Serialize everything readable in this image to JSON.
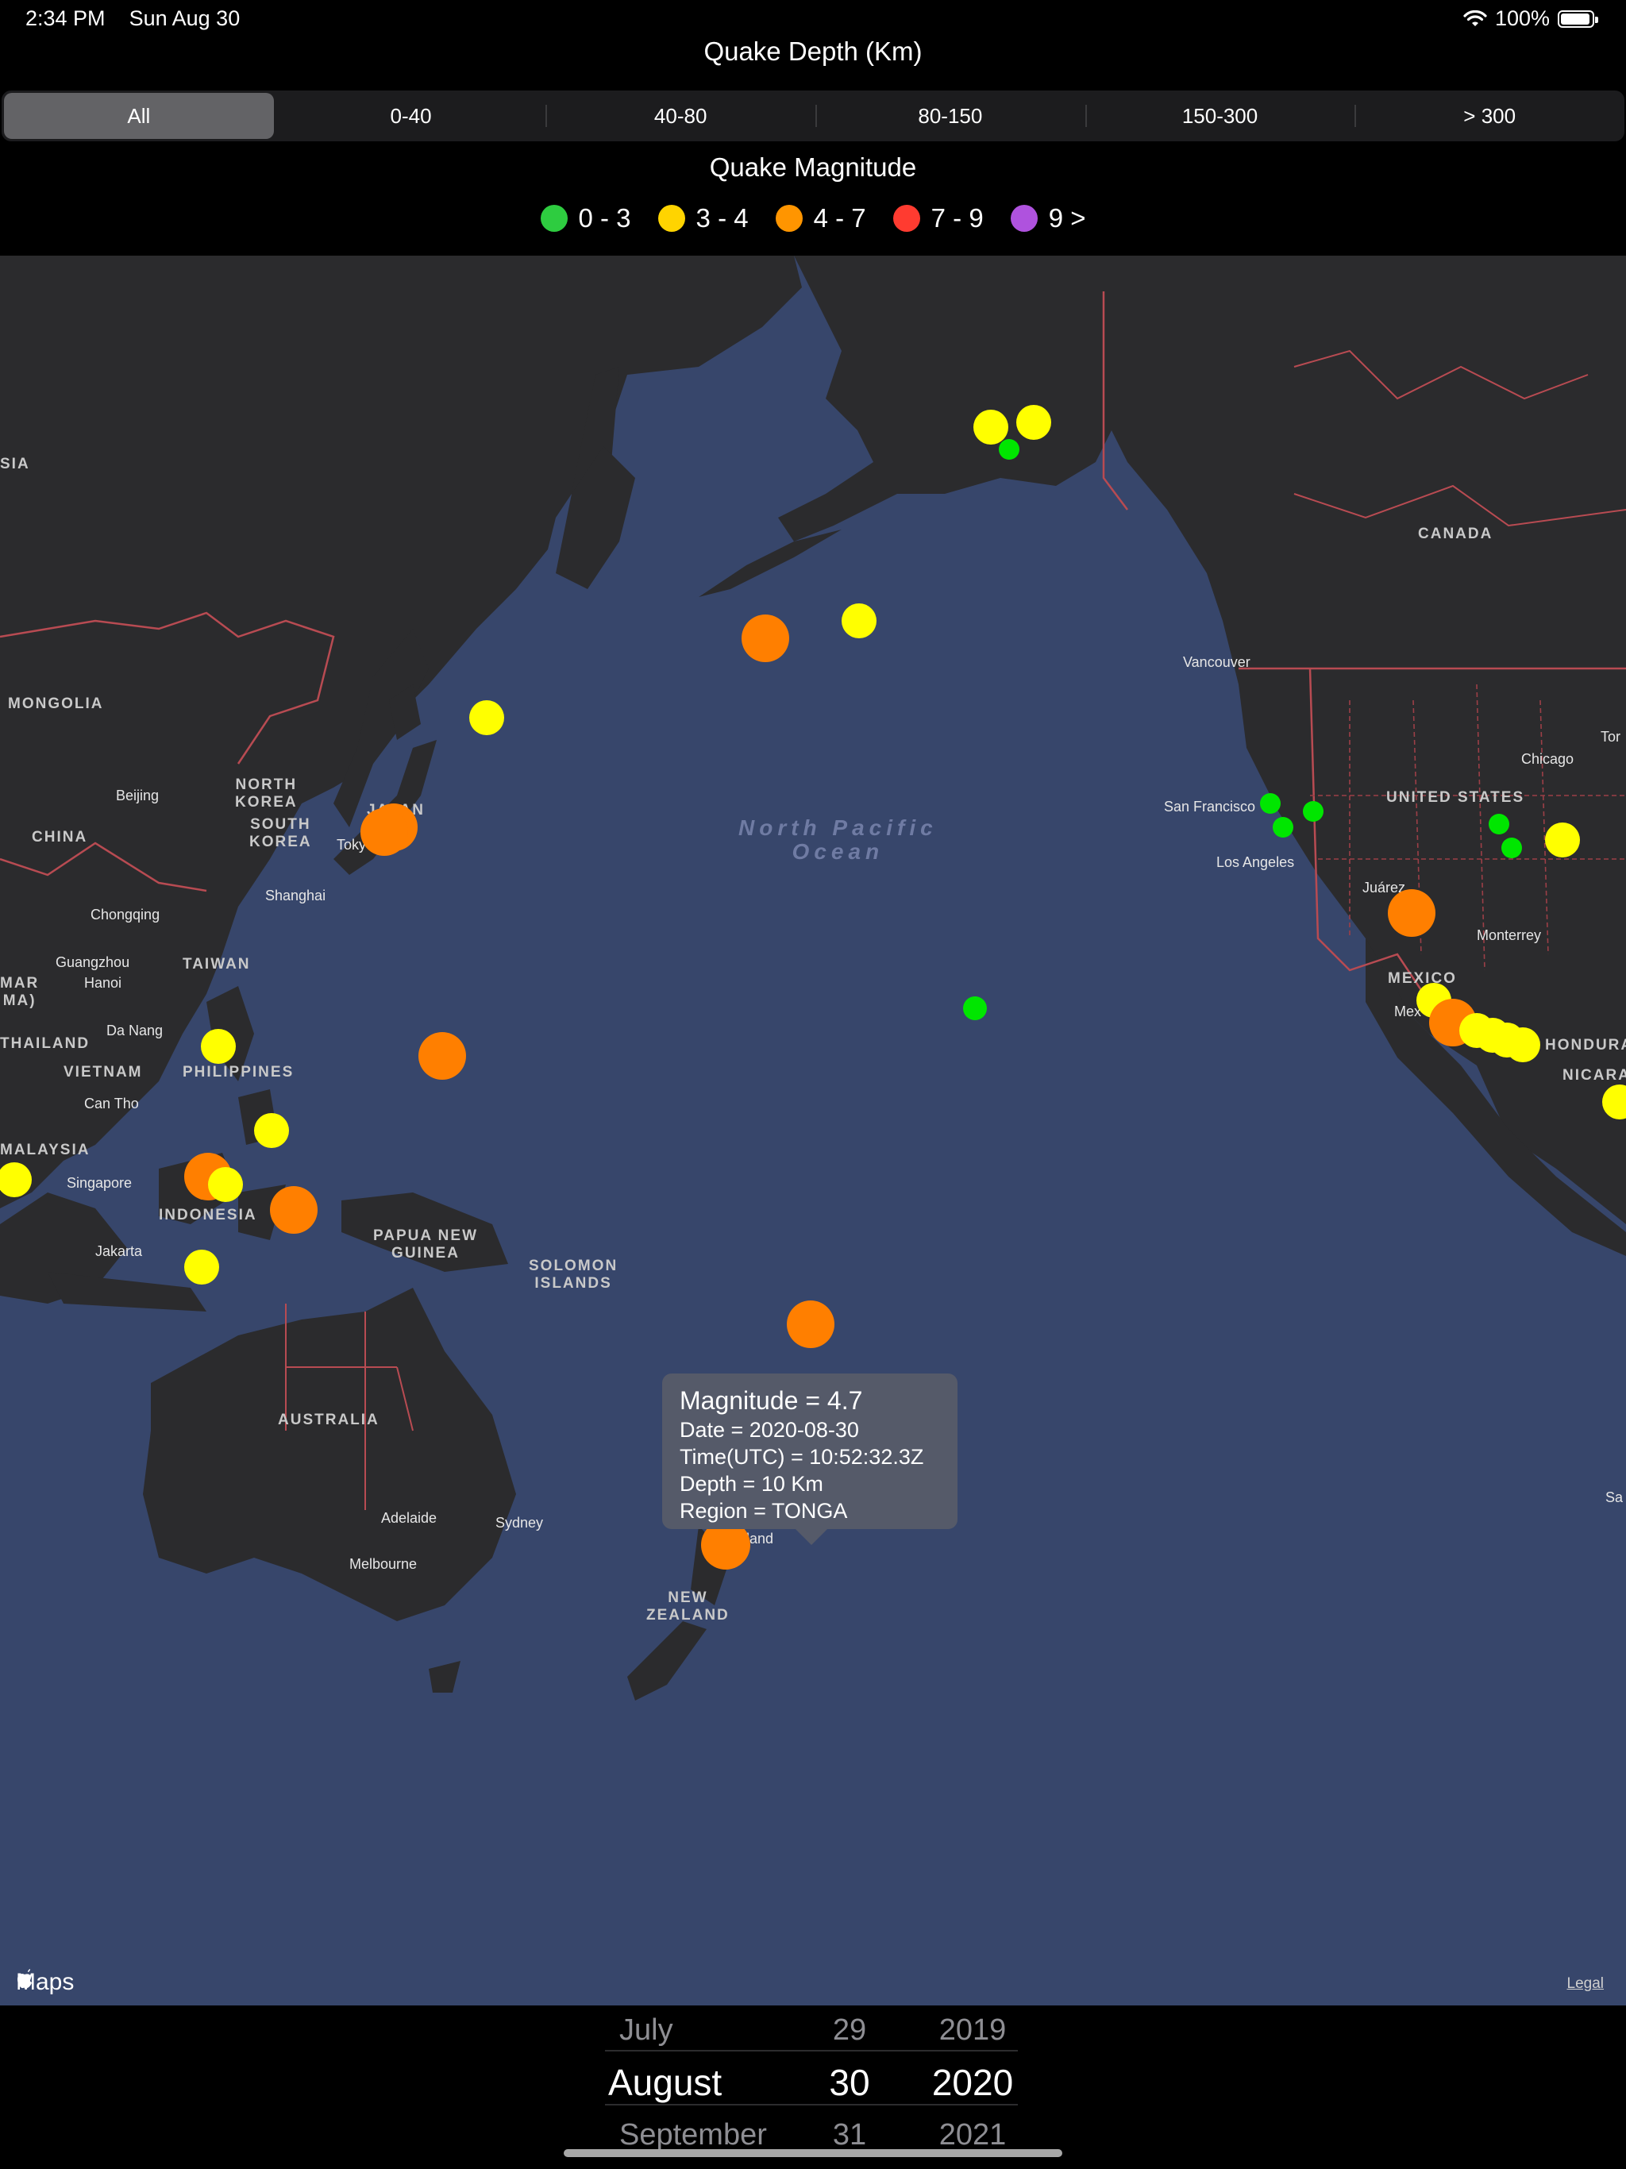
{
  "status": {
    "time": "2:34 PM",
    "date": "Sun Aug 30",
    "battery": "100%"
  },
  "depth_filter": {
    "title": "Quake Depth (Km)",
    "segments": [
      "All",
      "0-40",
      "40-80",
      "80-150",
      "150-300",
      "> 300"
    ],
    "selected": "All"
  },
  "magnitude_legend": {
    "title": "Quake Magnitude",
    "items": [
      {
        "label": "0 - 3",
        "color": "#2ecc40"
      },
      {
        "label": "3 - 4",
        "color": "#ffd400"
      },
      {
        "label": "4 - 7",
        "color": "#ff9500"
      },
      {
        "label": "7 - 9",
        "color": "#ff3b30"
      },
      {
        "label": "9 >",
        "color": "#af52de"
      }
    ]
  },
  "map": {
    "ocean_label_1": "North Pacific",
    "ocean_label_2": "Ocean",
    "countries": {
      "sia": "SIA",
      "mongolia": "MONGOLIA",
      "china": "CHINA",
      "north_korea_1": "NORTH",
      "north_korea_2": "KOREA",
      "south_korea_1": "SOUTH",
      "south_korea_2": "KOREA",
      "japan": "JAPAN",
      "taiwan": "TAIWAN",
      "philippines": "PHILIPPINES",
      "vietnam": "VIETNAM",
      "thailand": "THAILAND",
      "myanmar_1": "MAR",
      "myanmar_2": "MA)",
      "malaysia": "MALAYSIA",
      "indonesia": "INDONESIA",
      "png_1": "PAPUA NEW",
      "png_2": "GUINEA",
      "solomon_1": "SOLOMON",
      "solomon_2": "ISLANDS",
      "australia": "AUSTRALIA",
      "nz_1": "NEW",
      "nz_2": "ZEALAND",
      "canada": "CANADA",
      "usa": "UNITED STATES",
      "mexico": "MEXICO",
      "honduras": "HONDURA",
      "nicaragua": "NICARA"
    },
    "cities": {
      "beijing": "Beijing",
      "shanghai": "Shanghai",
      "chongqing": "Chongqing",
      "guangzhou": "Guangzhou",
      "hanoi": "Hanoi",
      "danang": "Da Nang",
      "canTho": "Can Tho",
      "singapore": "Singapore",
      "jakarta": "Jakarta",
      "tokyo": "Toky",
      "adelaide": "Adelaide",
      "sydney": "Sydney",
      "melbourne": "Melbourne",
      "auckland": "land",
      "vancouver": "Vancouver",
      "sanfrancisco": "San Francisco",
      "losangeles": "Los Angeles",
      "chicago": "Chicago",
      "toronto": "Tor",
      "juarez": "Juárez",
      "monterrey": "Monterrey",
      "mexicocity": "Mex",
      "sa": "Sa"
    },
    "callout": {
      "magnitude": "Magnitude = 4.7",
      "date": "Date = 2020-08-30",
      "time": "Time(UTC) = 10:52:32.3Z",
      "depth": "Depth = 10 Km",
      "region": "Region = TONGA"
    },
    "attribution": "Maps",
    "legal": "Legal"
  },
  "quakes": [
    {
      "class": "3-4",
      "magnitude_band": "3 - 4"
    },
    {
      "class": "0-3",
      "magnitude_band": "0 - 3"
    },
    {
      "class": "4-7",
      "magnitude_band": "4 - 7"
    }
  ],
  "date_picker": {
    "months": [
      "July",
      "August",
      "September"
    ],
    "days": [
      "29",
      "30",
      "31"
    ],
    "years": [
      "2019",
      "2020",
      "2021"
    ],
    "selected": {
      "month": "August",
      "day": "30",
      "year": "2020"
    }
  }
}
